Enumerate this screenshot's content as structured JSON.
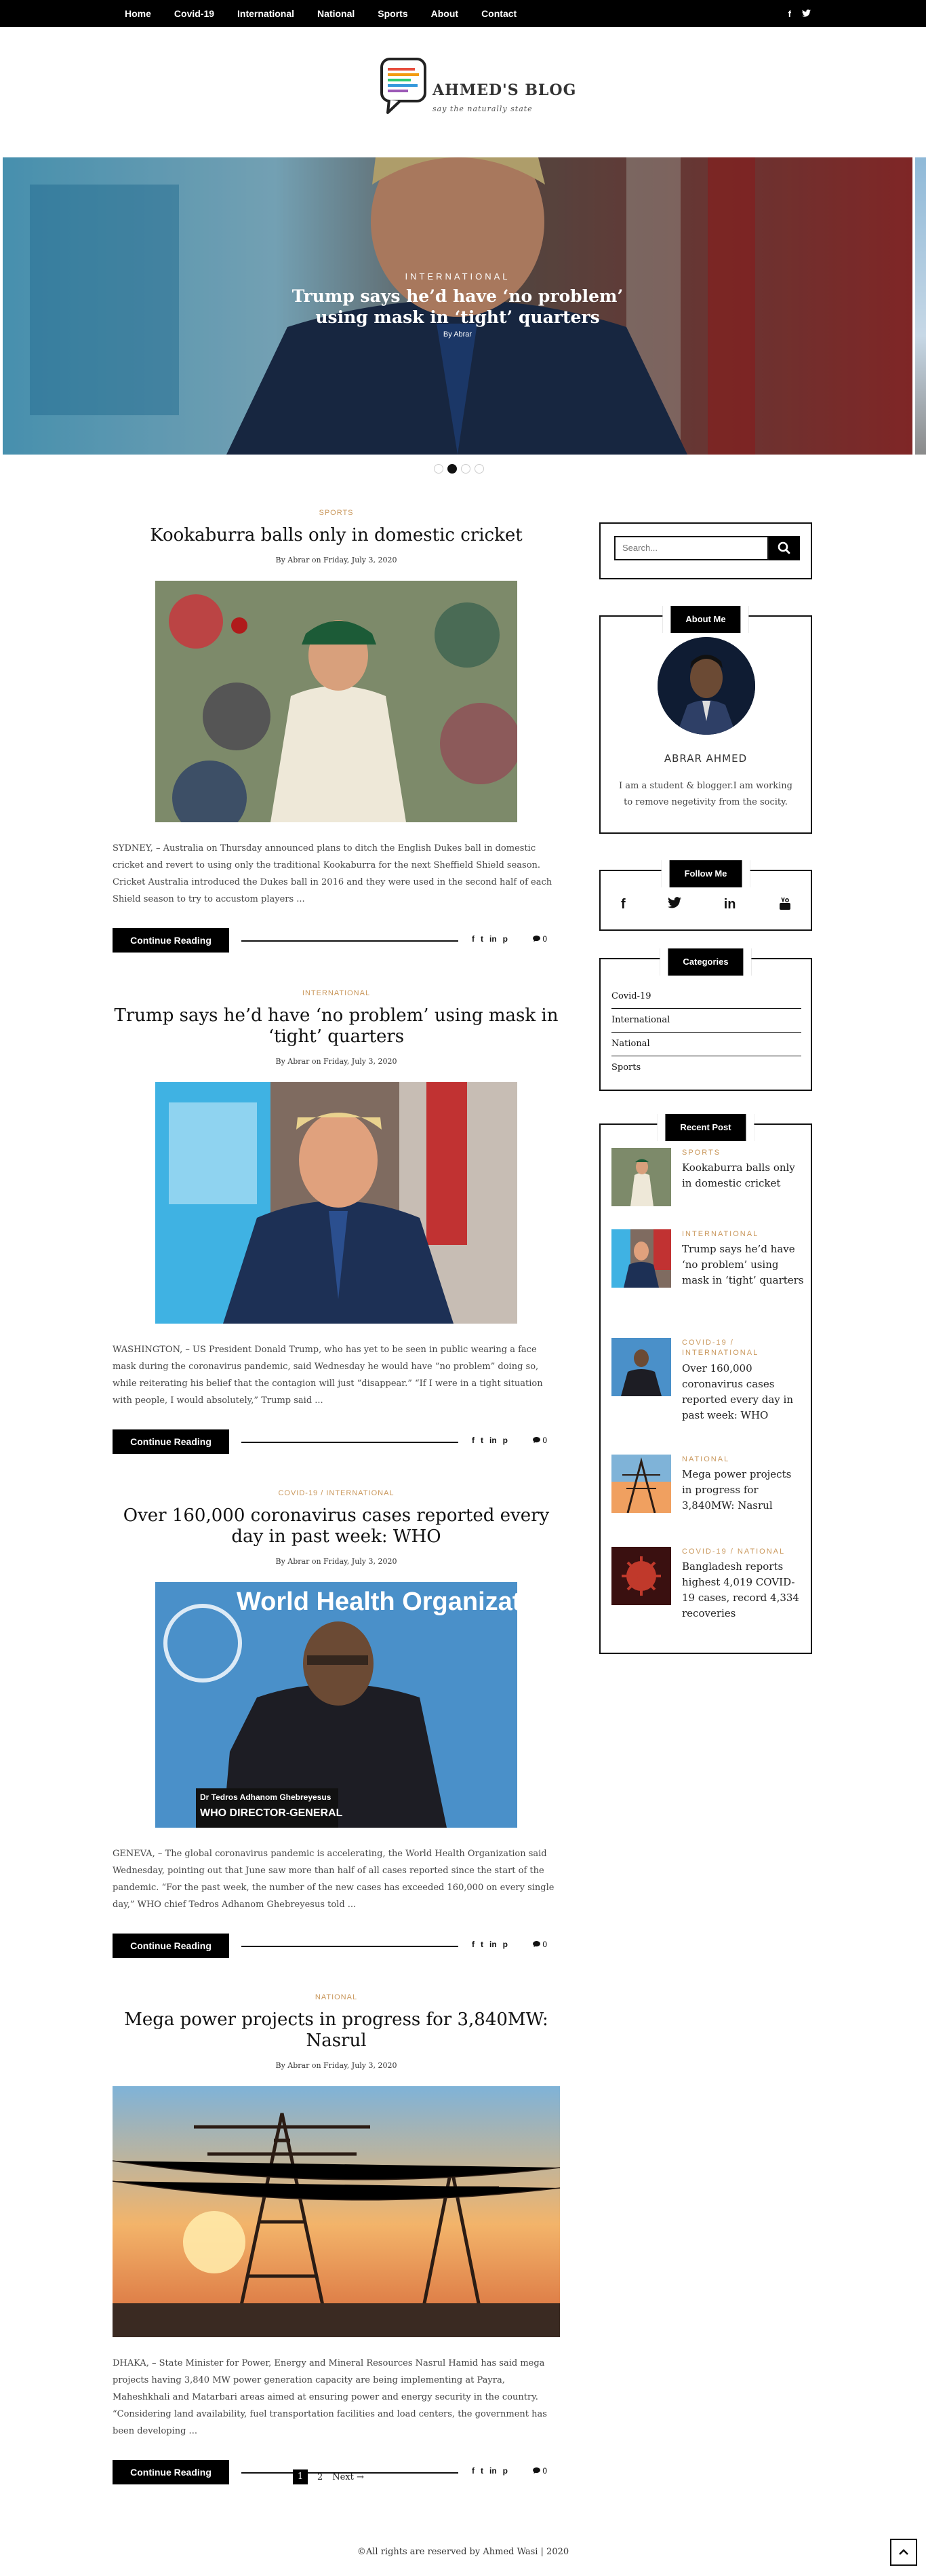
{
  "nav": {
    "items": [
      "Home",
      "Covid-19",
      "International",
      "National",
      "Sports",
      "About",
      "Contact"
    ],
    "social": [
      "f",
      "t"
    ]
  },
  "logo": {
    "name": "AHMED'S BLOG",
    "tagline": "say the naturally state"
  },
  "slider": {
    "category": "INTERNATIONAL",
    "title_line1": "Trump says he’d have ‘no problem’",
    "title_line2": "using mask in ‘tight’ quarters",
    "by": "By Abrar",
    "dots": 4,
    "active_dot": 1
  },
  "posts": [
    {
      "category": "SPORTS",
      "title": "Kookaburra balls only in domestic cricket",
      "byline": "By Abrar on Friday, July 3, 2020",
      "excerpt": "SYDNEY, – Australia on Thursday announced plans to ditch the English Dukes ball in domestic cricket and revert to using only the traditional Kookaburra for the next Sheffield Shield season. Cricket Australia introduced the Dukes ball in 2016 and they were used in the second half of each Shield season to try to accustom players ...",
      "read": "Continue Reading",
      "comments": "0"
    },
    {
      "category": "INTERNATIONAL",
      "title": "Trump says he’d have ‘no problem’ using mask in ‘tight’ quarters",
      "byline": "By Abrar on Friday, July 3, 2020",
      "excerpt": "WASHINGTON, – US President Donald Trump, who has yet to be seen in public wearing a face mask during the coronavirus pandemic, said Wednesday he would have “no problem” doing so, while reiterating his belief that the contagion will just “disappear.” “If I were in a tight situation with people, I would absolutely,” Trump said ...",
      "read": "Continue Reading",
      "comments": "0"
    },
    {
      "category": "COVID-19 / INTERNATIONAL",
      "title": "Over 160,000 coronavirus cases reported every day in past week: WHO",
      "byline": "By Abrar on Friday, July 3, 2020",
      "excerpt": "GENEVA, – The global coronavirus pandemic is accelerating, the World Health Organization said Wednesday, pointing out that June saw more than half of all cases reported since the start of the pandemic. “For the past week, the number of the new cases has exceeded 160,000 on every single day,” WHO chief Tedros Adhanom Ghebreyesus told ...",
      "read": "Continue Reading",
      "comments": "0",
      "img_caption_1": "Dr Tedros Adhanom Ghebreyesus",
      "img_caption_2": "WHO DIRECTOR-GENERAL",
      "img_banner": "World Health Organization"
    },
    {
      "category": "NATIONAL",
      "title": "Mega power projects in progress for 3,840MW: Nasrul",
      "byline": "By Abrar on Friday, July 3, 2020",
      "excerpt": "DHAKA, – State Minister for Power, Energy and Mineral Resources Nasrul Hamid has said mega projects having 3,840 MW power generation capacity are being implementing at Payra, Maheshkhali and Matarbari areas aimed at ensuring power and energy security in the country. “Considering land availability, fuel transportation facilities and load centers, the government has been developing ...",
      "read": "Continue Reading",
      "comments": "0"
    }
  ],
  "pagination": {
    "current": "1",
    "next_page": "2",
    "next": "Next →"
  },
  "sidebar": {
    "search_placeholder": "Search...",
    "about": {
      "title": "About Me",
      "name": "ABRAR AHMED",
      "desc": "I am a student & blogger.I am working to remove negetivity from the socity."
    },
    "follow": {
      "title": "Follow Me",
      "icons": [
        "f",
        "t",
        "in",
        "yt"
      ]
    },
    "categories": {
      "title": "Categories",
      "items": [
        "Covid-19",
        "International",
        "National",
        "Sports"
      ]
    },
    "recent": {
      "title": "Recent Post",
      "items": [
        {
          "category": "SPORTS",
          "title": "Kookaburra balls only in domestic cricket"
        },
        {
          "category": "INTERNATIONAL",
          "title": "Trump says he’d have ‘no problem’ using mask in ‘tight’ quarters"
        },
        {
          "category": "COVID-19 / INTERNATIONAL",
          "title": "Over 160,000 coronavirus cases reported every day in past week: WHO"
        },
        {
          "category": "NATIONAL",
          "title": "Mega power projects in progress for 3,840MW: Nasrul"
        },
        {
          "category": "COVID-19 / NATIONAL",
          "title": "Bangladesh reports highest 4,019 COVID-19 cases, record 4,334 recoveries"
        }
      ]
    }
  },
  "footer": {
    "copyright": "©All rights are reserved by Ahmed Wasi | 2020"
  },
  "colors": {
    "accent": "#c9975b",
    "dark": "#000000"
  }
}
